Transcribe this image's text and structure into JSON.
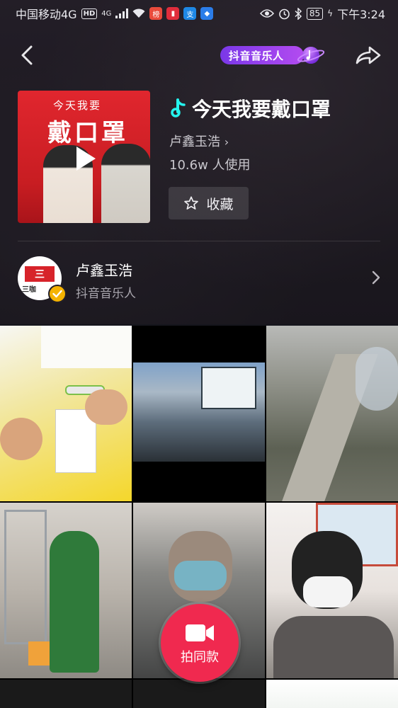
{
  "status_bar": {
    "carrier": "中国移动4G",
    "hd": "HD",
    "net": "4G",
    "battery": "85",
    "time": "下午3:24"
  },
  "nav": {
    "badge_label": "抖音音乐人"
  },
  "song": {
    "cover_small_text": "今天我要",
    "cover_big_text": "戴口罩",
    "title": "今天我要戴口罩",
    "artist": "卢鑫玉浩",
    "usage": "10.6w 人使用",
    "favorite_label": "收藏"
  },
  "artist": {
    "logo_text": "三",
    "logo_caption": "三咖",
    "name": "卢鑫玉浩",
    "role": "抖音音乐人"
  },
  "record": {
    "label": "拍同款"
  },
  "colors": {
    "accent": "#f0294f",
    "badge_purple": "#7a38e8",
    "verified_gold": "#f5b300"
  }
}
